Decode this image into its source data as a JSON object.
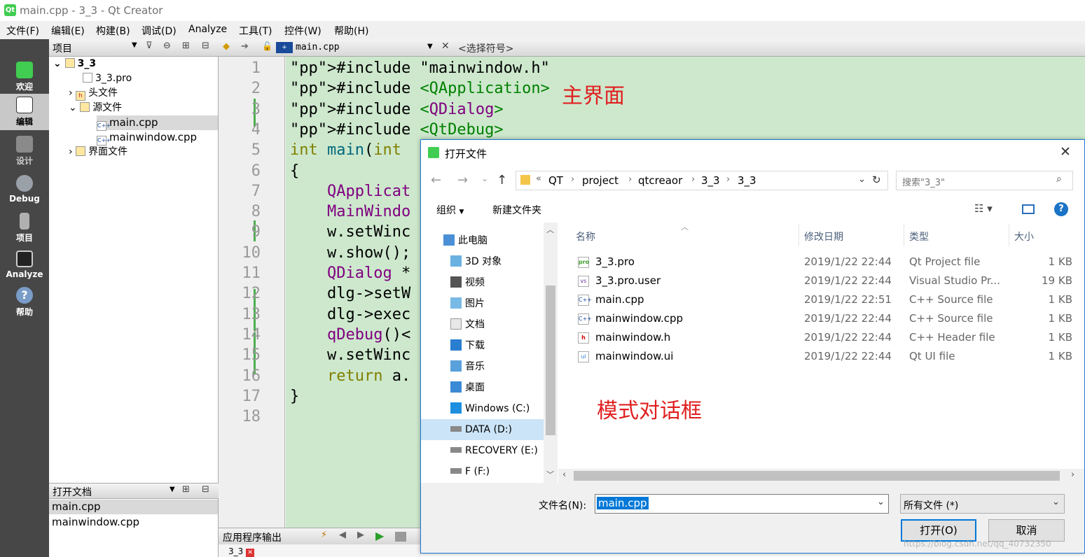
{
  "window": {
    "title": "main.cpp - 3_3 - Qt Creator",
    "logo": "Qt"
  },
  "menu": [
    "文件(F)",
    "编辑(E)",
    "构建(B)",
    "调试(D)",
    "Analyze",
    "工具(T)",
    "控件(W)",
    "帮助(H)"
  ],
  "modes": [
    {
      "label": "欢迎",
      "icon": "qt-logo-icon"
    },
    {
      "label": "编辑",
      "icon": "edit-document-icon"
    },
    {
      "label": "设计",
      "icon": "design-icon"
    },
    {
      "label": "Debug",
      "icon": "debug-icon"
    },
    {
      "label": "项目",
      "icon": "project-icon"
    },
    {
      "label": "Analyze",
      "icon": "analyze-icon"
    },
    {
      "label": "帮助",
      "icon": "help-icon"
    }
  ],
  "project_panel": {
    "header": "项目",
    "tree": [
      {
        "label": "3_3",
        "level": 0,
        "expanded": true
      },
      {
        "label": "3_3.pro",
        "level": 1
      },
      {
        "label": "头文件",
        "level": 1,
        "expanded": false
      },
      {
        "label": "源文件",
        "level": 1,
        "expanded": true
      },
      {
        "label": "main.cpp",
        "level": 2,
        "selected": true
      },
      {
        "label": "mainwindow.cpp",
        "level": 2
      },
      {
        "label": "界面文件",
        "level": 1,
        "expanded": false
      }
    ]
  },
  "open_docs": {
    "header": "打开文档",
    "items": [
      "main.cpp",
      "mainwindow.cpp"
    ]
  },
  "editor": {
    "file_tab": "main.cpp",
    "symbol_selector": "<选择符号>",
    "line_numbers": [
      "1",
      "2",
      "3",
      "4",
      "5",
      "6",
      "7",
      "8",
      "9",
      "10",
      "11",
      "12",
      "13",
      "14",
      "15",
      "16",
      "17",
      "18"
    ],
    "lines": [
      "#include \"mainwindow.h\"",
      "#include <QApplication>",
      "#include <QDialog>",
      "#include <QtDebug>",
      "int main(int",
      "{",
      "    QApplicat",
      "    MainWindo",
      "    w.setWinc",
      "    w.show();",
      "    QDialog *",
      "    dlg->setW",
      "    dlg->exec",
      "    qDebug()<",
      "    w.setWinc",
      "    return a.",
      "}",
      ""
    ]
  },
  "annotations": {
    "main": "主界面",
    "dialog": "模式对话框"
  },
  "bottom_panel": {
    "header": "应用程序输出",
    "tab": "3_3"
  },
  "dialog": {
    "title": "打开文件",
    "breadcrumb": [
      "QT",
      "project",
      "qtcreaor",
      "3_3",
      "3_3"
    ],
    "search_placeholder": "搜索\"3_3\"",
    "organize": "组织",
    "new_folder": "新建文件夹",
    "sidebar": [
      {
        "label": "此电脑",
        "icon": "computer-icon",
        "indent": 0
      },
      {
        "label": "3D 对象",
        "icon": "folder-3d-icon",
        "indent": 1
      },
      {
        "label": "视频",
        "icon": "video-folder-icon",
        "indent": 1
      },
      {
        "label": "图片",
        "icon": "pictures-folder-icon",
        "indent": 1
      },
      {
        "label": "文档",
        "icon": "documents-folder-icon",
        "indent": 1
      },
      {
        "label": "下载",
        "icon": "downloads-folder-icon",
        "indent": 1
      },
      {
        "label": "音乐",
        "icon": "music-folder-icon",
        "indent": 1
      },
      {
        "label": "桌面",
        "icon": "desktop-folder-icon",
        "indent": 1
      },
      {
        "label": "Windows (C:)",
        "icon": "windows-drive-icon",
        "indent": 1
      },
      {
        "label": "DATA (D:)",
        "icon": "drive-icon",
        "indent": 1,
        "selected": true
      },
      {
        "label": "RECOVERY (E:)",
        "icon": "drive-icon",
        "indent": 1
      },
      {
        "label": "F (F:)",
        "icon": "drive-icon",
        "indent": 1
      }
    ],
    "columns": [
      "名称",
      "修改日期",
      "类型",
      "大小"
    ],
    "files": [
      {
        "name": "3_3.pro",
        "date": "2019/1/22 22:44",
        "type": "Qt Project file",
        "size": "1 KB",
        "icon": "pro"
      },
      {
        "name": "3_3.pro.user",
        "date": "2019/1/22 22:44",
        "type": "Visual Studio Pr...",
        "size": "19 KB",
        "icon": "vs"
      },
      {
        "name": "main.cpp",
        "date": "2019/1/22 22:51",
        "type": "C++ Source file",
        "size": "1 KB",
        "icon": "C++"
      },
      {
        "name": "mainwindow.cpp",
        "date": "2019/1/22 22:44",
        "type": "C++ Source file",
        "size": "1 KB",
        "icon": "C++"
      },
      {
        "name": "mainwindow.h",
        "date": "2019/1/22 22:44",
        "type": "C++ Header file",
        "size": "1 KB",
        "icon": "h"
      },
      {
        "name": "mainwindow.ui",
        "date": "2019/1/22 22:44",
        "type": "Qt UI file",
        "size": "1 KB",
        "icon": "ui"
      }
    ],
    "filename_label": "文件名(N):",
    "filename_value": "main.cpp",
    "filter": "所有文件 (*)",
    "open_button": "打开(O)",
    "cancel_button": "取消"
  },
  "watermark": "https://blog.csdn.net/qq_40732350"
}
